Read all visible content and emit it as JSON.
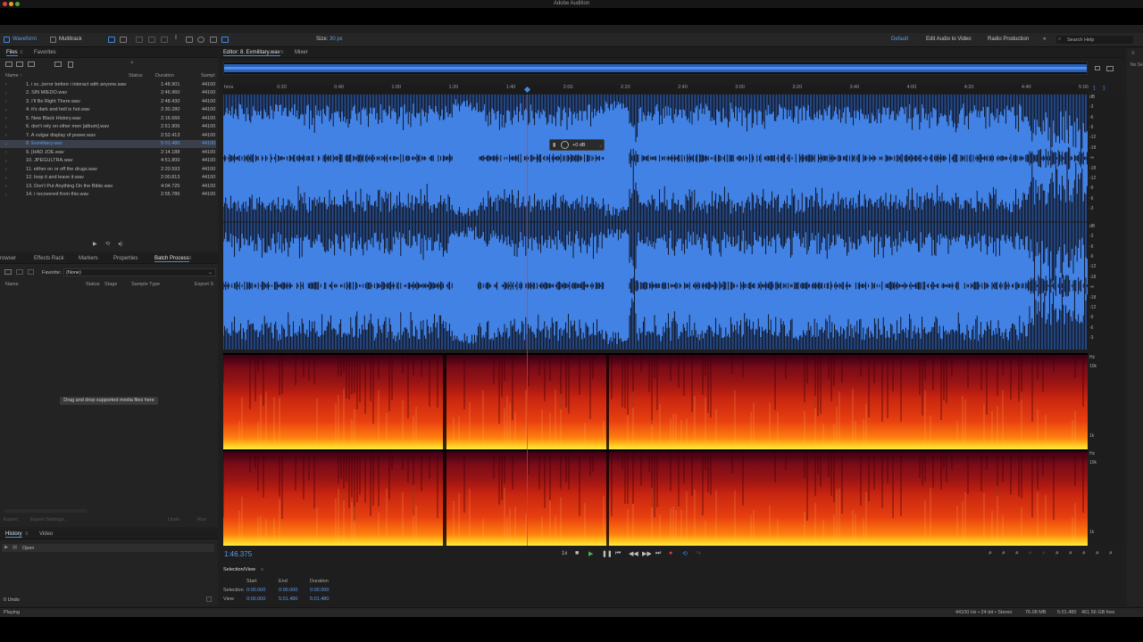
{
  "window": {
    "title": "Adobe Audition"
  },
  "toolbar": {
    "waveform_label": "Waveform",
    "multitrack_label": "Multitrack",
    "size_label": "Size:",
    "size_value": "30 px",
    "workspaces": [
      "Default",
      "Edit Audio to Video",
      "Radio Production"
    ],
    "more": "»",
    "search_placeholder": "Search Help"
  },
  "files_panel": {
    "tabs": [
      "Files",
      "Favorites"
    ],
    "columns": {
      "name": "Name ↑",
      "status": "Status",
      "duration": "Duration",
      "sample": "Sampl"
    },
    "rows": [
      {
        "name": "1. i sc..(error before i interact with anyone.wav",
        "duration": "1:48.901",
        "sr": "44100"
      },
      {
        "name": "2. SIN MIEDO.wav",
        "duration": "2:46.960",
        "sr": "44100"
      },
      {
        "name": "3. I'll Be Right There.wav",
        "duration": "2:48.430",
        "sr": "44100"
      },
      {
        "name": "4. it's dark and hell is hot.wav",
        "duration": "2:30.280",
        "sr": "44100"
      },
      {
        "name": "5. New Black History.wav",
        "duration": "2:16.666",
        "sr": "44100"
      },
      {
        "name": "6. don't rely on other men [album].wav",
        "duration": "2:51.906",
        "sr": "44100"
      },
      {
        "name": "7. A vulgar display of power.wav",
        "duration": "2:52.413",
        "sr": "44100"
      },
      {
        "name": "8. Exmilitary.wav",
        "duration": "5:01.480",
        "sr": "44100",
        "selected": true
      },
      {
        "name": "9. [HAD JOE.wav",
        "duration": "2:14.188",
        "sr": "44100"
      },
      {
        "name": "10. JPEGULTRA.wav",
        "duration": "4:51.800",
        "sr": "44100"
      },
      {
        "name": "11. either on or off the drugs.wav",
        "duration": "2:20.593",
        "sr": "44100"
      },
      {
        "name": "12. loop it and leave it.wav",
        "duration": "2:00.813",
        "sr": "44100"
      },
      {
        "name": "13. Don't Put Anything On the Bible.wav",
        "duration": "4:04.725",
        "sr": "44100"
      },
      {
        "name": "14. i recovered from this.wav",
        "duration": "2:55.786",
        "sr": "44100"
      }
    ]
  },
  "batch_panel": {
    "tabs": [
      "rowser",
      "Effects Rack",
      "Markers",
      "Properties",
      "Batch Process"
    ],
    "favorite_label": "Favorite:",
    "favorite_value": "(None)",
    "columns": [
      "Name",
      "Status",
      "Stage",
      "Sample Type",
      "Export S"
    ],
    "dropzone": "Drag and drop supported media files here",
    "export_btn": "Export",
    "export_settings_btn": "Export Settings...",
    "undo_btn": "Undo",
    "run_btn": "Run"
  },
  "history_panel": {
    "tabs": [
      "History",
      "Video"
    ],
    "items": [
      "Open"
    ],
    "undo_count": "0 Undo"
  },
  "editor": {
    "tabs": [
      "Editor: 8. Exmilitary.wav",
      "Mixer"
    ],
    "ruler_ticks": [
      "hms",
      "0:20",
      "0:40",
      "1:00",
      "1:20",
      "1:40",
      "2:00",
      "2:20",
      "2:40",
      "3:00",
      "3:20",
      "3:40",
      "4:00",
      "4:20",
      "4:40",
      "5:00"
    ],
    "gain_value": "+0 dB",
    "db_scale_ch1": [
      "dB",
      "-3",
      "-6",
      "-9",
      "-12",
      "-18",
      "-∞",
      "-18",
      "-12",
      "-9",
      "-6",
      "-3"
    ],
    "db_scale_ch2": [
      "dB",
      "-3",
      "-6",
      "-9",
      "-12",
      "-18",
      "-∞",
      "-18",
      "-12",
      "-9",
      "-6",
      "-3"
    ],
    "hz_scale_ch1": [
      "Hz",
      "10k",
      "1k"
    ],
    "hz_scale_ch2": [
      "Hz",
      "10k",
      "1k"
    ],
    "channel_labels": [
      "L",
      "R"
    ]
  },
  "transport": {
    "time": "1:46.375",
    "speed": "1x"
  },
  "selection_view": {
    "title": "Selection/View",
    "headers": [
      "Start",
      "End",
      "Duration"
    ],
    "selection_label": "Selection",
    "view_label": "View",
    "selection": [
      "0:00.000",
      "0:00.000",
      "0:00.000"
    ],
    "view": [
      "0:00.000",
      "5:01.480",
      "5:01.480"
    ]
  },
  "status_bar": {
    "state": "Playing",
    "format": "44100 Hz • 24-bit • Stereo",
    "size": "76.08 MB",
    "duration": "5:01.480",
    "free": "461.56 GB free"
  },
  "right_panel": {
    "label": "No Se"
  },
  "colors": {
    "waveform": "#4282e4",
    "accent": "#3f8ae0",
    "playhead": "#d04040",
    "timecode": "#5d9cec"
  }
}
